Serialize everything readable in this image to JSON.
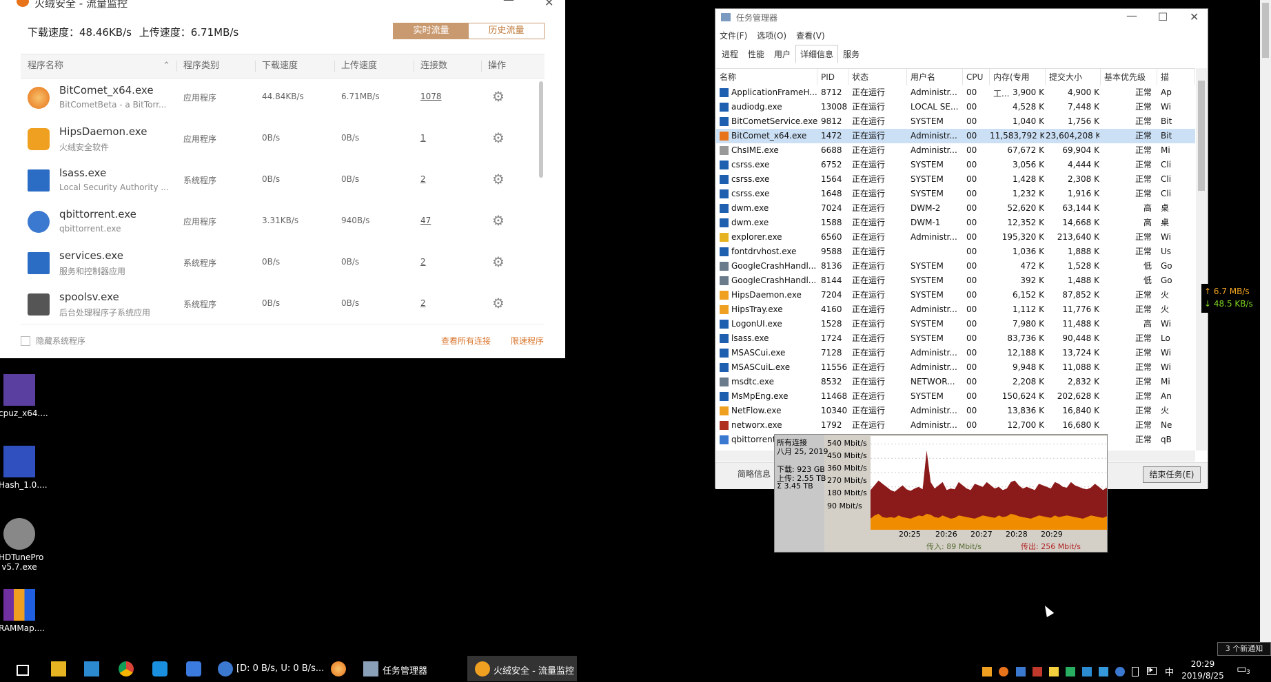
{
  "huorong": {
    "title": "火绒安全 - 流量监控",
    "download_label": "下载速度：48.46KB/s",
    "upload_label": "上传速度：6.71MB/s",
    "tab_realtime": "实时流量",
    "tab_history": "历史流量",
    "headers": [
      "程序名称",
      "程序类别",
      "下载速度",
      "上传速度",
      "连接数",
      "操作"
    ],
    "rows": [
      {
        "name": "BitComet_x64.exe",
        "desc": "BitCometBeta - a BitTorr...",
        "type": "应用程序",
        "down": "44.84KB/s",
        "up": "6.71MB/s",
        "conn": "1078"
      },
      {
        "name": "HipsDaemon.exe",
        "desc": "火绒安全软件",
        "type": "应用程序",
        "down": "0B/s",
        "up": "0B/s",
        "conn": "1"
      },
      {
        "name": "lsass.exe",
        "desc": "Local Security Authority ...",
        "type": "系统程序",
        "down": "0B/s",
        "up": "0B/s",
        "conn": "2"
      },
      {
        "name": "qbittorrent.exe",
        "desc": "qbittorrent.exe",
        "type": "应用程序",
        "down": "3.31KB/s",
        "up": "940B/s",
        "conn": "47"
      },
      {
        "name": "services.exe",
        "desc": "服务和控制器应用",
        "type": "系统程序",
        "down": "0B/s",
        "up": "0B/s",
        "conn": "2"
      },
      {
        "name": "spoolsv.exe",
        "desc": "后台处理程序子系统应用",
        "type": "系统程序",
        "down": "0B/s",
        "up": "0B/s",
        "conn": "2"
      }
    ],
    "hide_system": "隐藏系统程序",
    "view_all": "查看所有连接",
    "limit": "限速程序"
  },
  "desktop_icons": [
    {
      "label": "cpuz_x64....",
      "color": "#5b3fa0"
    },
    {
      "label": "Hash_1.0....",
      "color": "#3050c0"
    },
    {
      "label": "HDTunePro v5.7.exe",
      "color": "#888888"
    },
    {
      "label": "RAMMap....",
      "color": "#f0a020"
    }
  ],
  "taskmgr": {
    "title": "任务管理器",
    "menu": [
      "文件(F)",
      "选项(O)",
      "查看(V)"
    ],
    "tabs": [
      "进程",
      "性能",
      "用户",
      "详细信息",
      "服务"
    ],
    "active_tab": "详细信息",
    "columns": [
      "名称",
      "PID",
      "状态",
      "用户名",
      "CPU",
      "内存(专用工...",
      "提交大小",
      "基本优先级",
      "描"
    ],
    "rows": [
      {
        "name": "ApplicationFrameH...",
        "pid": "8712",
        "status": "正在运行",
        "user": "Administr...",
        "cpu": "00",
        "mem": "3,900 K",
        "commit": "4,900 K",
        "prio": "正常",
        "desc": "Ap",
        "icon": "#1f5fb0"
      },
      {
        "name": "audiodg.exe",
        "pid": "13008",
        "status": "正在运行",
        "user": "LOCAL SE...",
        "cpu": "00",
        "mem": "4,528 K",
        "commit": "7,448 K",
        "prio": "正常",
        "desc": "Wi",
        "icon": "#1f5fb0"
      },
      {
        "name": "BitCometService.exe",
        "pid": "9812",
        "status": "正在运行",
        "user": "SYSTEM",
        "cpu": "00",
        "mem": "1,040 K",
        "commit": "1,756 K",
        "prio": "正常",
        "desc": "Bit",
        "icon": "#1f5fb0"
      },
      {
        "name": "BitComet_x64.exe",
        "pid": "1472",
        "status": "正在运行",
        "user": "Administr...",
        "cpu": "00",
        "mem": "11,583,792 K",
        "commit": "23,604,208 K",
        "prio": "正常",
        "desc": "Bit",
        "icon": "#e8731a",
        "selected": true
      },
      {
        "name": "ChsIME.exe",
        "pid": "6688",
        "status": "正在运行",
        "user": "Administr...",
        "cpu": "00",
        "mem": "67,672 K",
        "commit": "69,904 K",
        "prio": "正常",
        "desc": "Mi",
        "icon": "#999999"
      },
      {
        "name": "csrss.exe",
        "pid": "6752",
        "status": "正在运行",
        "user": "SYSTEM",
        "cpu": "00",
        "mem": "3,056 K",
        "commit": "4,444 K",
        "prio": "正常",
        "desc": "Cli",
        "icon": "#1f5fb0"
      },
      {
        "name": "csrss.exe",
        "pid": "1564",
        "status": "正在运行",
        "user": "SYSTEM",
        "cpu": "00",
        "mem": "1,428 K",
        "commit": "2,308 K",
        "prio": "正常",
        "desc": "Cli",
        "icon": "#1f5fb0"
      },
      {
        "name": "csrss.exe",
        "pid": "1648",
        "status": "正在运行",
        "user": "SYSTEM",
        "cpu": "00",
        "mem": "1,232 K",
        "commit": "1,916 K",
        "prio": "正常",
        "desc": "Cli",
        "icon": "#1f5fb0"
      },
      {
        "name": "dwm.exe",
        "pid": "7024",
        "status": "正在运行",
        "user": "DWM-2",
        "cpu": "00",
        "mem": "52,620 K",
        "commit": "63,144 K",
        "prio": "高",
        "desc": "桌",
        "icon": "#1f5fb0"
      },
      {
        "name": "dwm.exe",
        "pid": "1588",
        "status": "正在运行",
        "user": "DWM-1",
        "cpu": "00",
        "mem": "12,352 K",
        "commit": "14,668 K",
        "prio": "高",
        "desc": "桌",
        "icon": "#1f5fb0"
      },
      {
        "name": "explorer.exe",
        "pid": "6560",
        "status": "正在运行",
        "user": "Administr...",
        "cpu": "00",
        "mem": "195,320 K",
        "commit": "213,640 K",
        "prio": "正常",
        "desc": "Wi",
        "icon": "#e6b422"
      },
      {
        "name": "fontdrvhost.exe",
        "pid": "9588",
        "status": "正在运行",
        "user": "",
        "cpu": "00",
        "mem": "1,036 K",
        "commit": "1,888 K",
        "prio": "正常",
        "desc": "Us",
        "icon": "#1f5fb0"
      },
      {
        "name": "GoogleCrashHandl...",
        "pid": "8136",
        "status": "正在运行",
        "user": "SYSTEM",
        "cpu": "00",
        "mem": "472 K",
        "commit": "1,528 K",
        "prio": "低",
        "desc": "Go",
        "icon": "#6a7b8c"
      },
      {
        "name": "GoogleCrashHandl...",
        "pid": "8144",
        "status": "正在运行",
        "user": "SYSTEM",
        "cpu": "00",
        "mem": "392 K",
        "commit": "1,488 K",
        "prio": "低",
        "desc": "Go",
        "icon": "#6a7b8c"
      },
      {
        "name": "HipsDaemon.exe",
        "pid": "7204",
        "status": "正在运行",
        "user": "SYSTEM",
        "cpu": "00",
        "mem": "6,152 K",
        "commit": "87,852 K",
        "prio": "正常",
        "desc": "火",
        "icon": "#f0a020"
      },
      {
        "name": "HipsTray.exe",
        "pid": "4160",
        "status": "正在运行",
        "user": "Administr...",
        "cpu": "00",
        "mem": "1,112 K",
        "commit": "11,776 K",
        "prio": "正常",
        "desc": "火",
        "icon": "#f0a020"
      },
      {
        "name": "LogonUI.exe",
        "pid": "1528",
        "status": "正在运行",
        "user": "SYSTEM",
        "cpu": "00",
        "mem": "7,980 K",
        "commit": "11,488 K",
        "prio": "高",
        "desc": "Wi",
        "icon": "#1f5fb0"
      },
      {
        "name": "lsass.exe",
        "pid": "1724",
        "status": "正在运行",
        "user": "SYSTEM",
        "cpu": "00",
        "mem": "83,736 K",
        "commit": "90,448 K",
        "prio": "正常",
        "desc": "Lo",
        "icon": "#1f5fb0"
      },
      {
        "name": "MSASCui.exe",
        "pid": "7128",
        "status": "正在运行",
        "user": "Administr...",
        "cpu": "00",
        "mem": "12,188 K",
        "commit": "13,724 K",
        "prio": "正常",
        "desc": "Wi",
        "icon": "#1f5fb0"
      },
      {
        "name": "MSASCuiL.exe",
        "pid": "11556",
        "status": "正在运行",
        "user": "Administr...",
        "cpu": "00",
        "mem": "9,948 K",
        "commit": "11,088 K",
        "prio": "正常",
        "desc": "Wi",
        "icon": "#1f5fb0"
      },
      {
        "name": "msdtc.exe",
        "pid": "8532",
        "status": "正在运行",
        "user": "NETWOR...",
        "cpu": "00",
        "mem": "2,208 K",
        "commit": "2,832 K",
        "prio": "正常",
        "desc": "Mi",
        "icon": "#6a7b8c"
      },
      {
        "name": "MsMpEng.exe",
        "pid": "11468",
        "status": "正在运行",
        "user": "SYSTEM",
        "cpu": "00",
        "mem": "150,624 K",
        "commit": "202,628 K",
        "prio": "正常",
        "desc": "An",
        "icon": "#1f5fb0"
      },
      {
        "name": "NetFlow.exe",
        "pid": "10340",
        "status": "正在运行",
        "user": "Administr...",
        "cpu": "00",
        "mem": "13,836 K",
        "commit": "16,840 K",
        "prio": "正常",
        "desc": "火",
        "icon": "#f0a020"
      },
      {
        "name": "networx.exe",
        "pid": "1792",
        "status": "正在运行",
        "user": "Administr...",
        "cpu": "00",
        "mem": "12,700 K",
        "commit": "16,680 K",
        "prio": "正常",
        "desc": "Ne",
        "icon": "#b03020"
      },
      {
        "name": "qbittorrent",
        "pid": "",
        "status": "",
        "user": "",
        "cpu": "",
        "mem": "",
        "commit": "K",
        "prio": "正常",
        "desc": "qB",
        "icon": "#3b78d0"
      }
    ],
    "brief": "简略信息",
    "end_task": "结束任务(E)"
  },
  "netflow": {
    "all_conn": "所有连接",
    "date": "八月 25, 2019",
    "down_total": "下载: 923 GB",
    "up_total": "上传: 2.55 TB",
    "sum_total": "Σ 3.45 TB",
    "in_label": "传入: 89 Mbit/s",
    "out_label": "传出: 256 Mbit/s"
  },
  "side_speed": {
    "up": "↑ 6.7 MB/s",
    "down": "↓ 48.5 KB/s",
    "up_color": "#f5a623",
    "down_color": "#7ed321"
  },
  "taskbar": {
    "qb_label": "[D: 0 B/s, U: 0 B/s...",
    "tm_label": "任务管理器",
    "hr_label": "火绒安全 - 流量监控",
    "ime": "中",
    "time": "20:29",
    "date": "2019/8/25",
    "notify": "3 个新通知",
    "badge": "3"
  },
  "chart_data": {
    "type": "area",
    "title": "",
    "x_ticks": [
      "20:25",
      "20:26",
      "20:27",
      "20:28",
      "20:29"
    ],
    "y_ticks": [
      "540 Mbit/s",
      "450 Mbit/s",
      "360 Mbit/s",
      "270 Mbit/s",
      "180 Mbit/s",
      "90 Mbit/s"
    ],
    "ylim": [
      0,
      590
    ],
    "series": [
      {
        "name": "传出",
        "color": "#8b1a1a",
        "values": [
          250,
          280,
          310,
          290,
          270,
          250,
          240,
          260,
          280,
          255,
          245,
          260,
          270,
          255,
          500,
          300,
          260,
          280,
          300,
          250,
          260,
          255,
          300,
          280,
          260,
          250,
          290,
          280,
          270,
          300,
          280,
          260,
          270,
          250,
          260,
          300,
          310,
          280,
          260,
          270,
          260,
          250,
          290,
          280,
          270,
          260,
          300,
          290,
          270,
          265,
          300,
          280,
          270,
          260,
          255,
          265,
          290,
          270,
          250,
          265
        ]
      },
      {
        "name": "传入",
        "color": "#f08c00",
        "values": [
          70,
          90,
          100,
          80,
          75,
          80,
          75,
          90,
          80,
          75,
          70,
          80,
          90,
          85,
          100,
          95,
          80,
          75,
          90,
          80,
          70,
          75,
          90,
          85,
          80,
          75,
          70,
          80,
          90,
          85,
          80,
          75,
          90,
          80,
          85,
          100,
          95,
          85,
          80,
          75,
          70,
          80,
          90,
          85,
          80,
          75,
          90,
          80,
          85,
          90,
          85,
          80,
          75,
          70,
          80,
          90,
          85,
          80,
          75,
          85
        ]
      }
    ]
  }
}
